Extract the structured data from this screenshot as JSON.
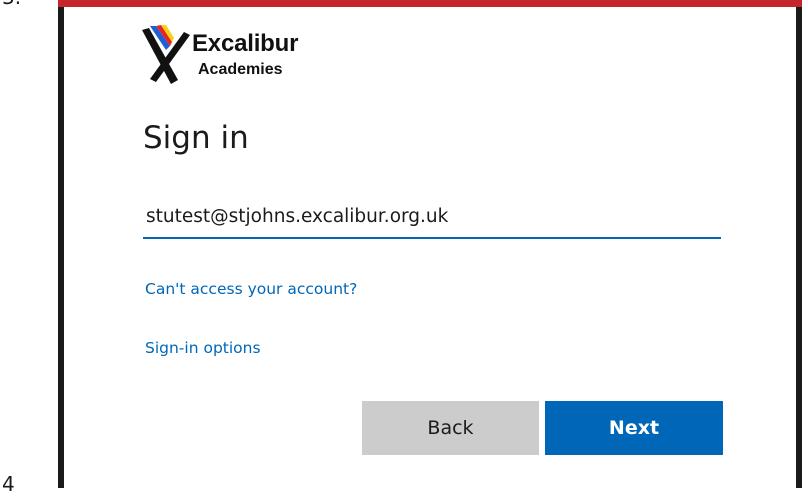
{
  "doc": {
    "step_top": "3.",
    "step_bottom": "4"
  },
  "colors": {
    "accent": "#0067b8",
    "frame": "#1a1a1a",
    "red_rule": "#c8242b",
    "back_button": "#cccccc"
  },
  "logo": {
    "title": "Excalibur",
    "subtitle": "Academies"
  },
  "signin": {
    "title": "Sign in",
    "email_value": "stutest@stjohns.excalibur.org.uk",
    "cant_access_link": "Can't access your account?",
    "signin_options_link": "Sign-in options",
    "back_label": "Back",
    "next_label": "Next"
  }
}
